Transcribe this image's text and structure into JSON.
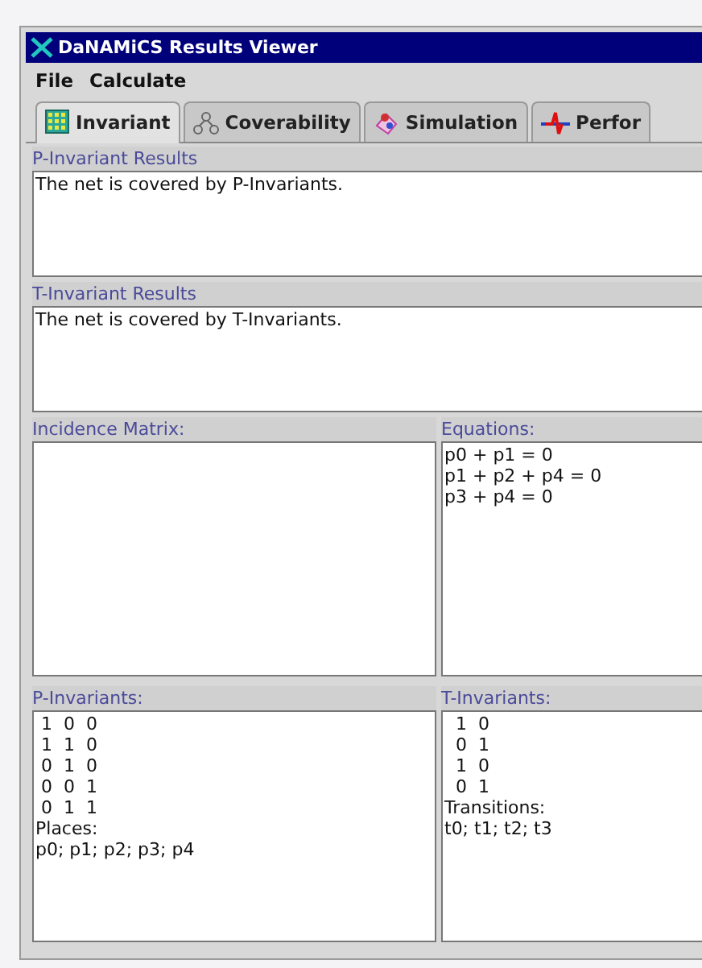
{
  "window": {
    "title": "DaNAMiCS Results Viewer"
  },
  "menu": [
    "File",
    "Calculate"
  ],
  "tabs": [
    {
      "label": "Invariant",
      "selected": true,
      "kind": "grid"
    },
    {
      "label": "Coverability",
      "selected": false,
      "kind": "tree"
    },
    {
      "label": "Simulation",
      "selected": false,
      "kind": "sim"
    },
    {
      "label": "Perfor",
      "selected": false,
      "kind": "perf"
    }
  ],
  "p_invariant_results": {
    "label": "P-Invariant Results",
    "text": "The net is covered by P-Invariants."
  },
  "t_invariant_results": {
    "label": "T-Invariant Results",
    "text": "The net is covered by T-Invariants."
  },
  "incidence_matrix": {
    "label": "Incidence Matrix:"
  },
  "equations": {
    "label": "Equations:",
    "lines": [
      "p0 + p1 = 0",
      "p1 + p2 + p4 = 0",
      "p3 + p4 = 0"
    ]
  },
  "p_invariants": {
    "label": "P-Invariants:",
    "lines": [
      " 1  0  0",
      " 1  1  0",
      " 0  1  0",
      " 0  0  1",
      " 0  1  1",
      "Places:",
      "p0; p1; p2; p3; p4"
    ]
  },
  "t_invariants": {
    "label": "T-Invariants:",
    "lines": [
      "  1  0",
      "  0  1",
      "  1  0",
      "  0  1",
      "Transitions:",
      "t0; t1; t2; t3"
    ]
  }
}
